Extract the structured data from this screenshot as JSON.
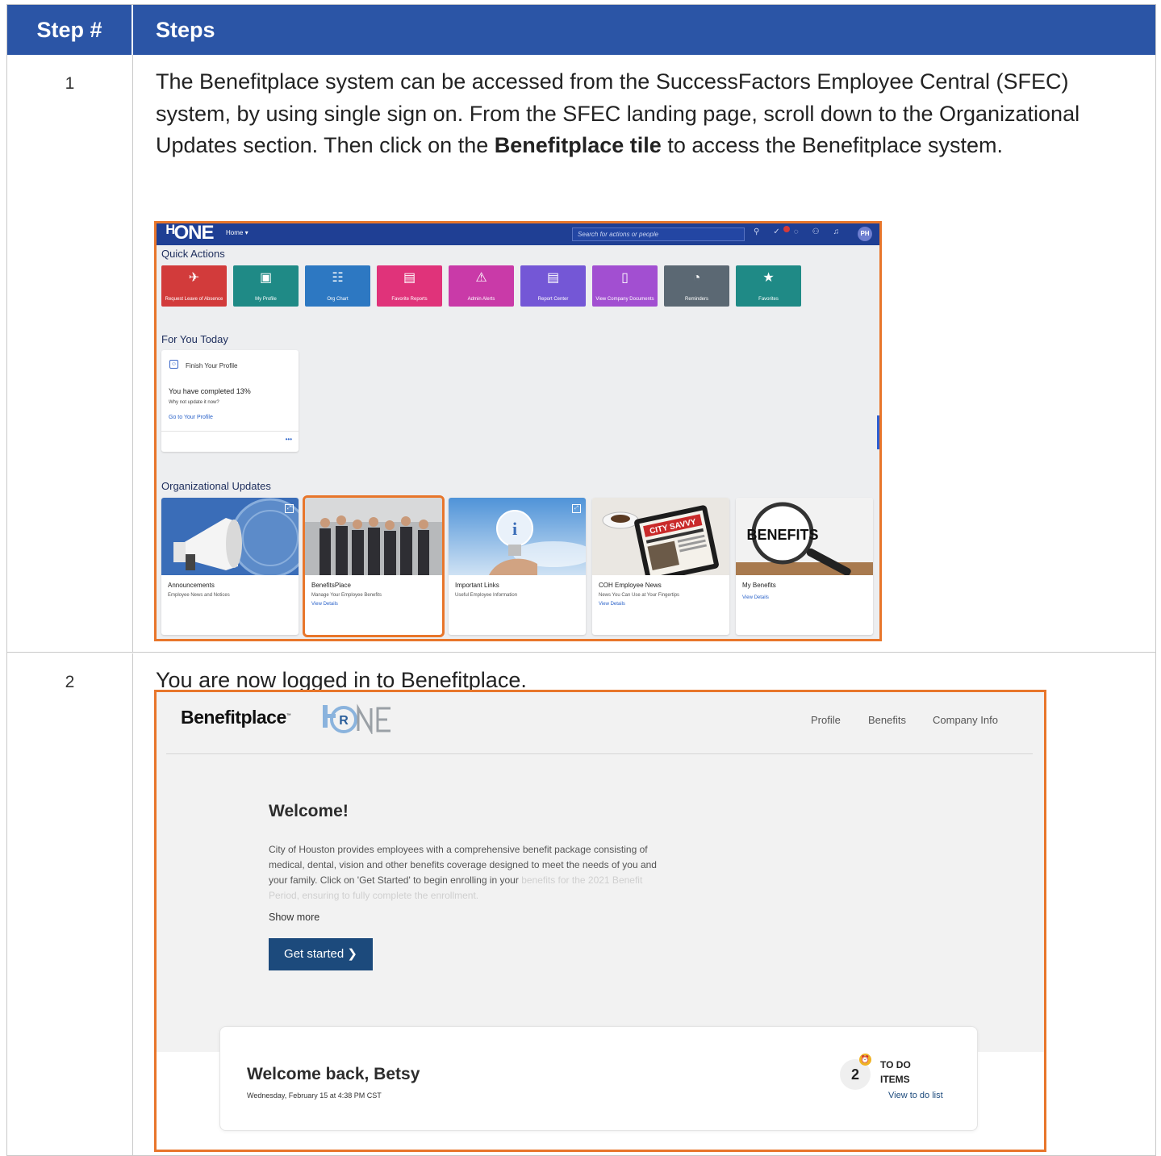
{
  "table": {
    "header_step": "Step #",
    "header_steps": "Steps",
    "row1_num": "1",
    "row1_text_a": "The Benefitplace system can be accessed from the SuccessFactors Employee Central (SFEC) system, by using single sign on. From the SFEC landing page, scroll down to the Organizational Updates section. Then click on the ",
    "row1_text_bold": "Benefitplace tile",
    "row1_text_b": " to access the Benefitplace system.",
    "row2_num": "2",
    "row2_text": "You are now logged in to Benefitplace."
  },
  "sfec": {
    "logo": "HR ONE",
    "home_menu": "Home ▾",
    "search_placeholder": "Search for actions or people",
    "avatar": "PH",
    "quick_actions_title": "Quick Actions",
    "quick_actions": [
      {
        "label": "Request Leave of Absence",
        "icon": "plane-icon",
        "glyph": "✈",
        "color": "#d23b3b"
      },
      {
        "label": "My Profile",
        "icon": "profile-card-icon",
        "glyph": "▣",
        "color": "#1f8a86"
      },
      {
        "label": "Org Chart",
        "icon": "org-chart-icon",
        "glyph": "☷",
        "color": "#2d78c2"
      },
      {
        "label": "Favorite Reports",
        "icon": "report-icon",
        "glyph": "▤",
        "color": "#e0337a"
      },
      {
        "label": "Admin Alerts",
        "icon": "alert-icon",
        "glyph": "⚠",
        "color": "#c93aa8"
      },
      {
        "label": "Report Center",
        "icon": "report-center-icon",
        "glyph": "▤",
        "color": "#7457d6"
      },
      {
        "label": "View Company Documents",
        "icon": "document-icon",
        "glyph": "▯",
        "color": "#a24fd1"
      },
      {
        "label": "Reminders",
        "icon": "reminder-icon",
        "glyph": "◔",
        "color": "#5b6873"
      },
      {
        "label": "Favorites",
        "icon": "star-icon",
        "glyph": "★",
        "color": "#1f8a86"
      }
    ],
    "for_you_today_title": "For You Today",
    "fyt_card_title": "Finish Your Profile",
    "fyt_pct": "You have completed 13%",
    "fyt_why": "Why not update it now?",
    "fyt_link": "Go to Your Profile",
    "fyt_more": "•••",
    "org_updates_title": "Organizational Updates",
    "org_updates": [
      {
        "title": "Announcements",
        "subtitle": "Employee News and Notices",
        "link": ""
      },
      {
        "title": "BenefitsPlace",
        "subtitle": "Manage Your Employee Benefits",
        "link": "View Details"
      },
      {
        "title": "Important Links",
        "subtitle": "Useful Employee Information",
        "link": ""
      },
      {
        "title": "COH Employee News",
        "subtitle": "News You Can Use at Your Fingertips",
        "link": "View Details"
      },
      {
        "title": "My Benefits",
        "subtitle": "",
        "link": "View Details"
      }
    ],
    "benefits_sign": "BENEFITS",
    "newspaper_masthead": "CITY SAVVY"
  },
  "benefitplace": {
    "logo": "Benefitplace",
    "logo_mark": "™",
    "hr_logo": "HR ONE",
    "nav": [
      "Profile",
      "Benefits",
      "Company Info"
    ],
    "welcome": "Welcome!",
    "para_visible": "City of Houston provides employees with a comprehensive benefit package consisting of medical, dental, vision and other benefits coverage designed to meet the needs of you and your family. Click on 'Get Started' to begin enrolling in your",
    "para_faded": "benefits for the 2021 Benefit Period, ensuring to fully complete the enrollment.",
    "show_more": "Show more",
    "get_started": "Get started ❯",
    "welcome_back": "Welcome back, Betsy",
    "date": "Wednesday, February 15 at 4:38 PM CST",
    "todo_count": "2",
    "todo_label_1": "TO DO",
    "todo_label_2": "ITEMS",
    "view_list": "View to do list"
  },
  "colors": {
    "header_blue": "#2b55a6",
    "highlight_orange": "#e8762b",
    "sfec_bar": "#1f3f94",
    "bp_button": "#1c4a7c"
  }
}
